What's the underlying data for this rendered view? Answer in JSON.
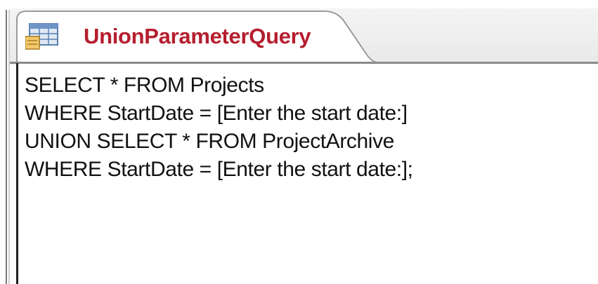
{
  "document_tab": {
    "title": "UnionParameterQuery",
    "icon": "query-datasheet-icon",
    "title_color": "#b51e2e"
  },
  "editor": {
    "lines": [
      "SELECT * FROM Projects",
      "WHERE StartDate = [Enter the start date:]",
      "UNION SELECT * FROM ProjectArchive",
      "WHERE StartDate = [Enter the start date:];"
    ]
  }
}
